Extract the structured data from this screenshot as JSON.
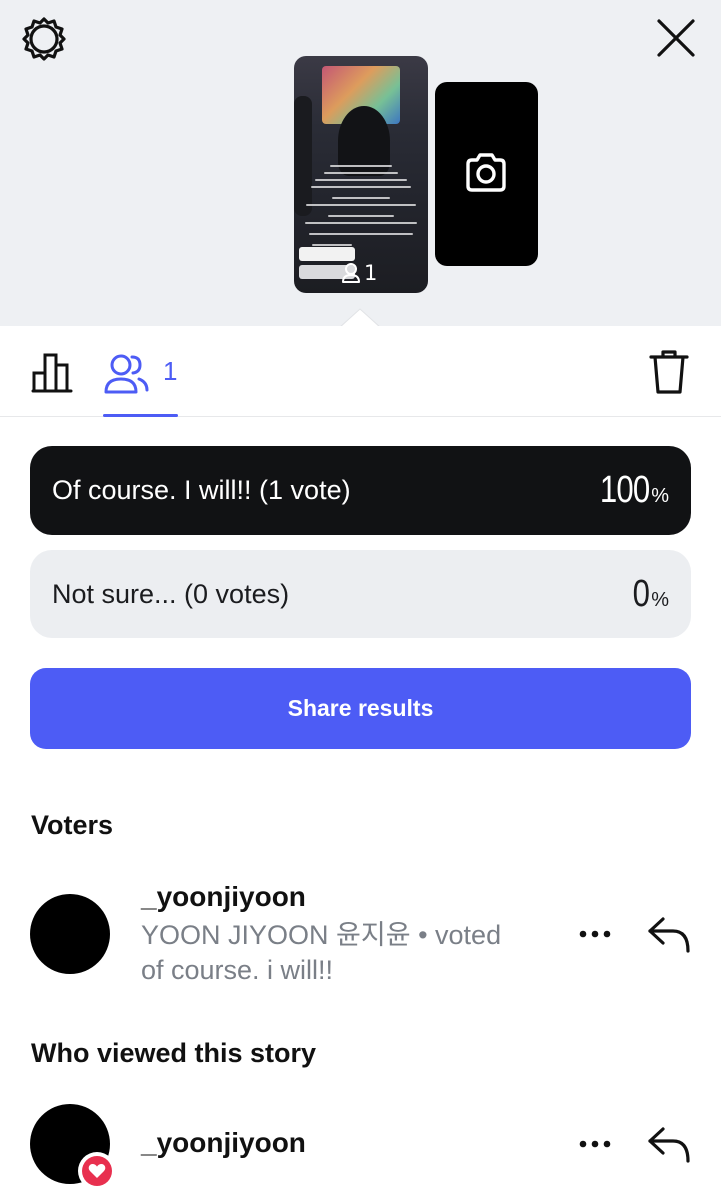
{
  "preview": {
    "story_vote_count": "1",
    "icons": {
      "settings": "gear-icon",
      "close": "close-icon",
      "camera": "camera-icon",
      "voters": "people-icon"
    }
  },
  "tabs": {
    "stats_icon": "bar-chart-icon",
    "voters_count": "1",
    "delete_icon": "trash-icon",
    "active_color": "#4d5cf5"
  },
  "poll": {
    "options": [
      {
        "label": "Of course. I will!! (1 vote)",
        "percent": "100",
        "percent_sign": "%",
        "style": "dark"
      },
      {
        "label": "Not sure... (0 votes)",
        "percent": "0",
        "percent_sign": "%",
        "style": "light"
      }
    ],
    "share_label": "Share results"
  },
  "voters": {
    "title": "Voters",
    "items": [
      {
        "username": "_yoonjiyoon",
        "name": "YOON JIYOON 윤지윤",
        "separator": "•",
        "status": "voted",
        "choice": "of course. i will!!"
      }
    ]
  },
  "viewers": {
    "title": "Who viewed this story",
    "items": [
      {
        "username": "_yoonjiyoon",
        "reaction": "heart-icon"
      }
    ]
  },
  "colors": {
    "accent": "#4d5cf5",
    "top_background": "#eef0f3",
    "dark_option": "#111214",
    "light_option": "#eceef1",
    "heart": "#e8304f"
  }
}
